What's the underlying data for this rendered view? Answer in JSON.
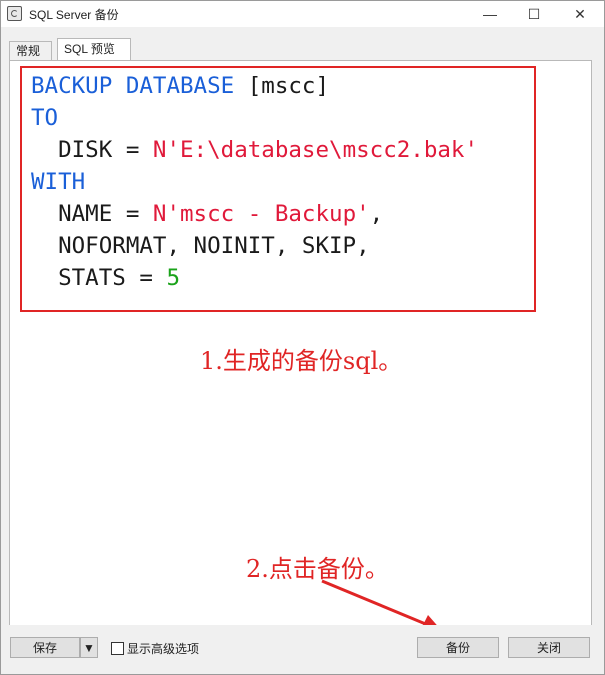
{
  "window": {
    "title": "SQL Server 备份",
    "controls": {
      "minimize": "—",
      "maximize": "☐",
      "close": "✕"
    }
  },
  "tabs": [
    {
      "label": "常规",
      "selected": false
    },
    {
      "label": "SQL 预览",
      "selected": true
    }
  ],
  "sql": [
    [
      {
        "t": "BACKUP DATABASE",
        "c": "kw"
      },
      {
        "t": " [mscc]",
        "c": "plain"
      }
    ],
    [
      {
        "t": "TO",
        "c": "kw"
      }
    ],
    [
      {
        "t": "  DISK = ",
        "c": "plain"
      },
      {
        "t": "N'E:\\database\\mscc2.bak'",
        "c": "str"
      }
    ],
    [
      {
        "t": "WITH",
        "c": "kw"
      }
    ],
    [
      {
        "t": "  NAME = ",
        "c": "plain"
      },
      {
        "t": "N'mscc - Backup'",
        "c": "str"
      },
      {
        "t": ",",
        "c": "plain"
      }
    ],
    [
      {
        "t": "  NOFORMAT, NOINIT, SKIP,",
        "c": "plain"
      }
    ],
    [
      {
        "t": "  STATS = ",
        "c": "plain"
      },
      {
        "t": "5",
        "c": "num"
      }
    ]
  ],
  "annotations": {
    "step1": "1.生成的备份sql。",
    "step2": "2.点击备份。"
  },
  "footer": {
    "save_label": "保存",
    "dropdown_icon": "▼",
    "show_advanced_label": "显示高级选项",
    "show_advanced_checked": false,
    "backup_label": "备份",
    "close_label": "关闭"
  },
  "colors": {
    "keyword": "#1a5fd8",
    "string": "#e0193a",
    "number": "#1aa31a",
    "annotation": "#e02525"
  }
}
